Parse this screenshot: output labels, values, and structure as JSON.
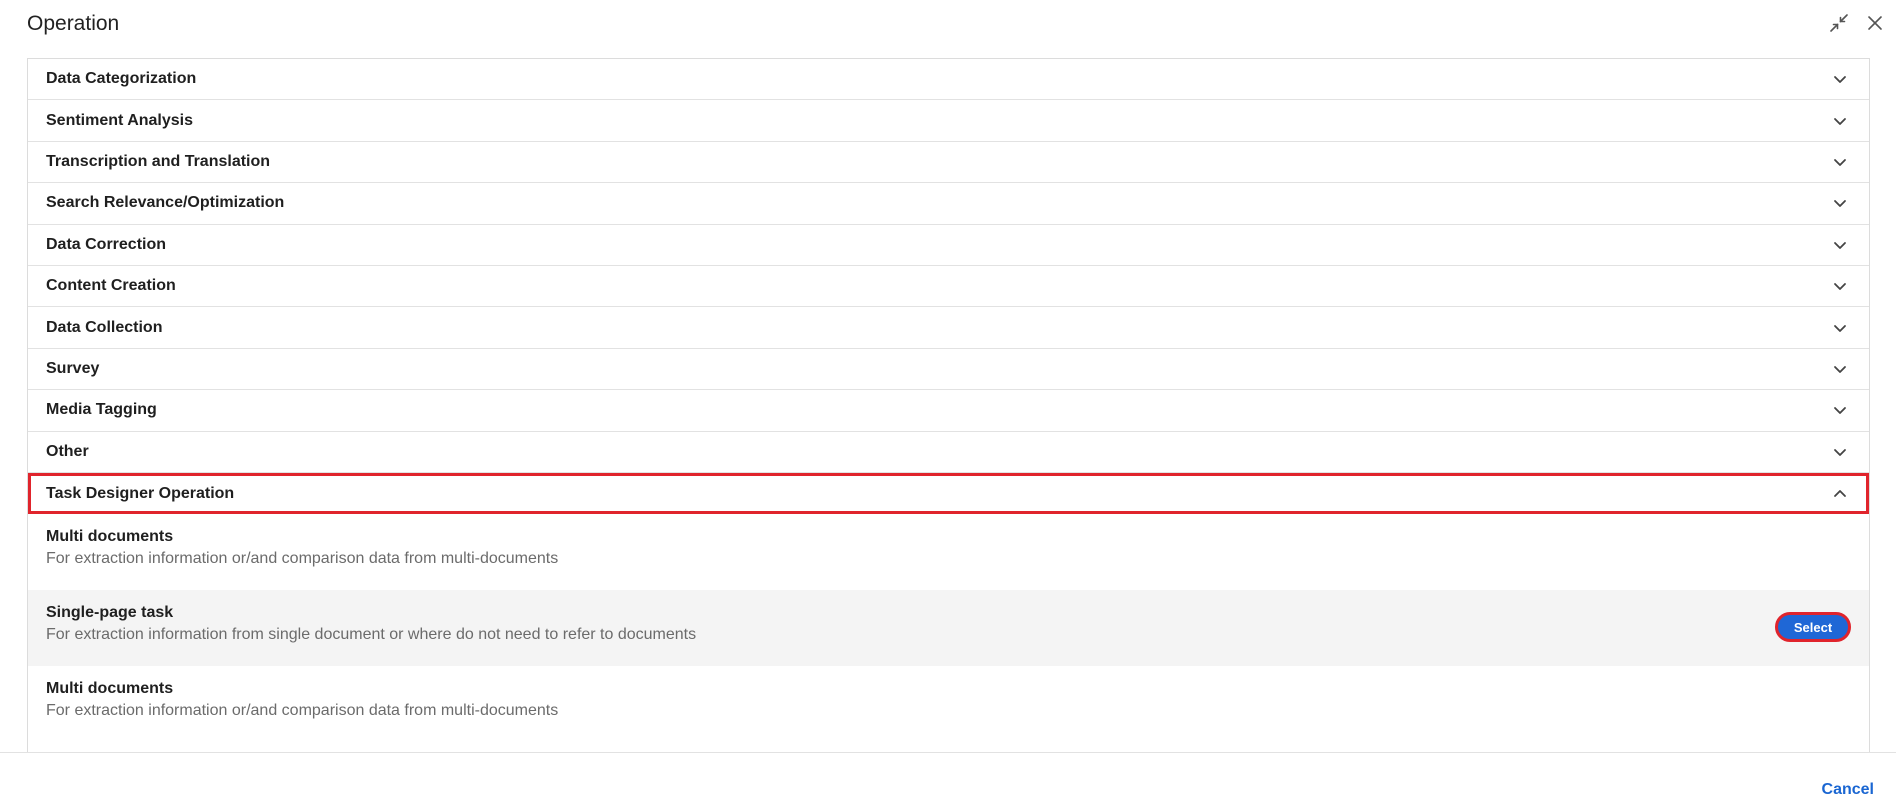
{
  "dialog": {
    "title": "Operation",
    "collapse_icon": "collapse-arrows-icon",
    "close_icon": "close-icon"
  },
  "categories": [
    {
      "label": "Data Categorization",
      "expanded": false
    },
    {
      "label": "Sentiment Analysis",
      "expanded": false
    },
    {
      "label": "Transcription and Translation",
      "expanded": false
    },
    {
      "label": "Search Relevance/Optimization",
      "expanded": false
    },
    {
      "label": "Data Correction",
      "expanded": false
    },
    {
      "label": "Content Creation",
      "expanded": false
    },
    {
      "label": "Data Collection",
      "expanded": false
    },
    {
      "label": "Survey",
      "expanded": false
    },
    {
      "label": "Media Tagging",
      "expanded": false
    },
    {
      "label": "Other",
      "expanded": false
    },
    {
      "label": "Task Designer Operation",
      "expanded": true
    }
  ],
  "tasks": [
    {
      "title": "Multi documents",
      "description": "For extraction information or/and comparison data from multi-documents"
    },
    {
      "title": "Single-page task",
      "description": "For extraction information from single document or where do not need to refer to documents",
      "button": "Select"
    },
    {
      "title": "Multi documents",
      "description": "For extraction information or/and comparison data from multi-documents"
    }
  ],
  "footer": {
    "cancel_label": "Cancel"
  },
  "colors": {
    "accent": "#1f67d6",
    "highlight": "#e0242c",
    "link": "#1a66d2"
  }
}
